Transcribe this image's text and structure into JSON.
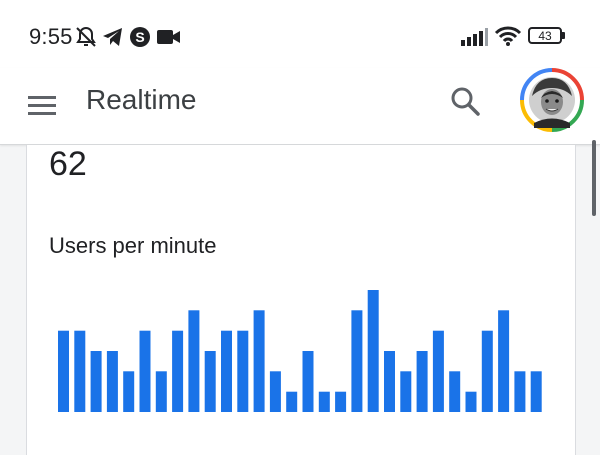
{
  "status_bar": {
    "time": "9:55",
    "battery": "43",
    "left_icons": [
      "notifications-off-icon",
      "telegram-icon",
      "skype-icon",
      "video-camera-icon"
    ],
    "right_icons": [
      "signal-icon",
      "wifi-icon",
      "battery-icon"
    ]
  },
  "app_bar": {
    "title": "Realtime",
    "menu_icon": "hamburger-menu-icon",
    "search_icon": "search-icon",
    "avatar": "account-avatar"
  },
  "card": {
    "users_count": "62",
    "chart_title": "Users per minute"
  },
  "colors": {
    "accent": "#1a73e8",
    "text": "#202124",
    "background": "#f4f5f6"
  },
  "chart_data": {
    "type": "bar",
    "title": "Users per minute",
    "values": [
      4,
      4,
      3,
      3,
      2,
      4,
      2,
      4,
      5,
      3,
      4,
      4,
      5,
      2,
      1,
      3,
      1,
      1,
      5,
      6,
      3,
      2,
      3,
      4,
      2,
      1,
      4,
      5,
      2,
      2
    ],
    "ylim": [
      0,
      6
    ],
    "grid": false
  }
}
